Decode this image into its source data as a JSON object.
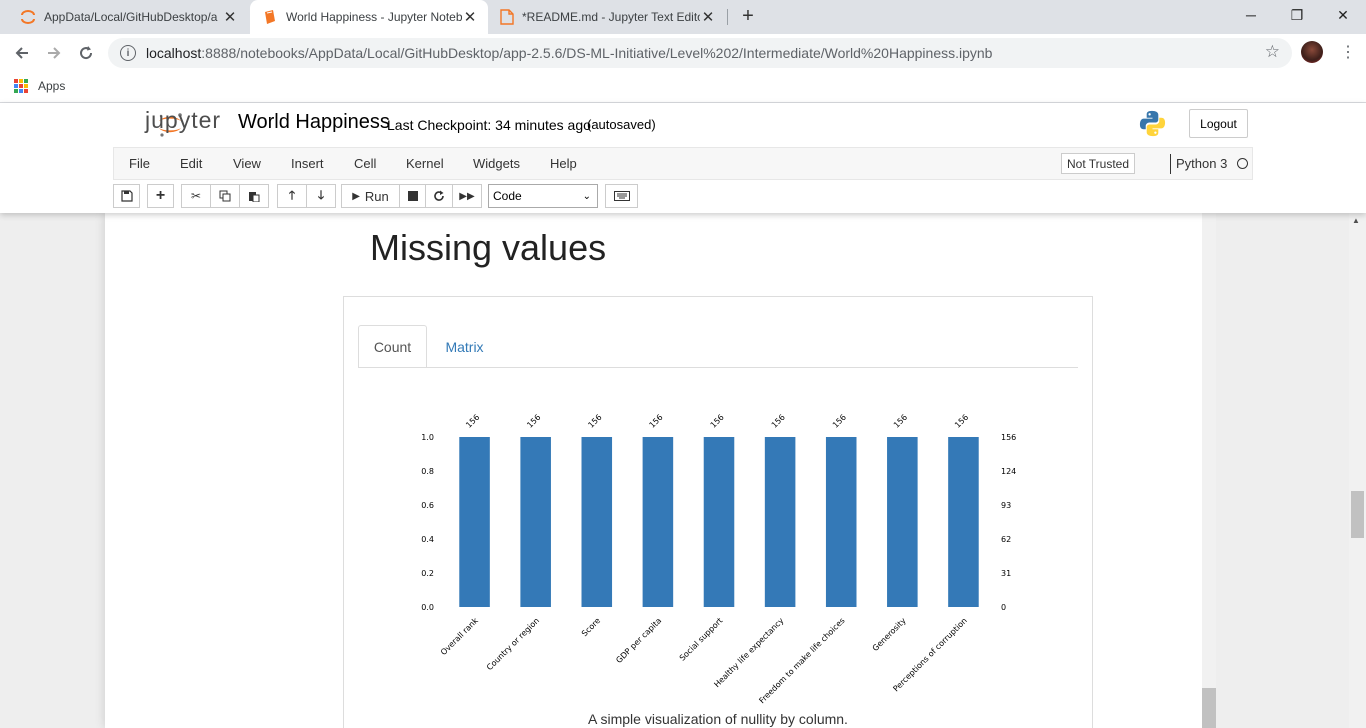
{
  "browser": {
    "tabs": [
      {
        "title": "AppData/Local/GitHubDesktop/a",
        "icon": "jupyter-icon",
        "active": false
      },
      {
        "title": "World Happiness - Jupyter Noteb",
        "icon": "notebook-icon",
        "active": true
      },
      {
        "title": "*README.md - Jupyter Text Edito",
        "icon": "file-icon",
        "active": false
      }
    ],
    "url_host": "localhost",
    "url_path": ":8888/notebooks/AppData/Local/GitHubDesktop/app-2.5.6/DS-ML-Initiative/Level%202/Intermediate/World%20Happiness.ipynb",
    "bookmarks_apps": "Apps"
  },
  "jupyter": {
    "logo_text": "jupyter",
    "notebook_name": "World Happiness",
    "checkpoint": "Last Checkpoint: 34 minutes ago",
    "autosaved": "(autosaved)",
    "logout": "Logout",
    "menu": [
      "File",
      "Edit",
      "View",
      "Insert",
      "Cell",
      "Kernel",
      "Widgets",
      "Help"
    ],
    "trust": "Not Trusted",
    "kernel": "Python 3",
    "run_label": "Run",
    "cell_type": "Code"
  },
  "notebook": {
    "heading": "Missing values",
    "tabs": [
      "Count",
      "Matrix"
    ],
    "caption": "A simple visualization of nullity by column."
  },
  "chart_data": {
    "type": "bar",
    "categories": [
      "Overall rank",
      "Country or region",
      "Score",
      "GDP per capita",
      "Social support",
      "Healthy life expectancy",
      "Freedom to make life choices",
      "Generosity",
      "Perceptions of corruption"
    ],
    "values": [
      1.0,
      1.0,
      1.0,
      1.0,
      1.0,
      1.0,
      1.0,
      1.0,
      1.0
    ],
    "counts": [
      156,
      156,
      156,
      156,
      156,
      156,
      156,
      156,
      156
    ],
    "ylim": [
      0,
      1
    ],
    "yticks": [
      "0.0",
      "0.2",
      "0.4",
      "0.6",
      "0.8",
      "1.0"
    ],
    "right_ticks": [
      "0",
      "31",
      "62",
      "93",
      "124",
      "156"
    ],
    "bar_color": "#3479b7",
    "title": "",
    "xlabel": "",
    "ylabel": ""
  }
}
